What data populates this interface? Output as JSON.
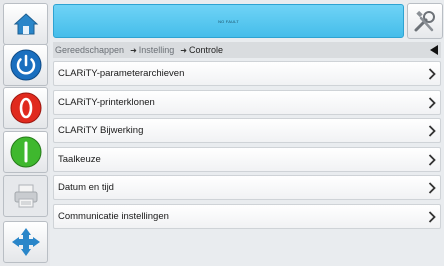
{
  "topbar": {
    "status_text": "NO FAULT"
  },
  "breadcrumb": {
    "root": "Gereedschappen",
    "middle": "Instelling",
    "current": "Controle"
  },
  "menu": {
    "items": [
      {
        "label": "CLARiTY-parameterarchieven"
      },
      {
        "label": "CLARiTY-printerklonen"
      },
      {
        "label": "CLARiTY Bijwerking"
      },
      {
        "label": "Taalkeuze"
      },
      {
        "label": "Datum en tijd"
      },
      {
        "label": "Communicatie instellingen"
      }
    ]
  },
  "icons": {
    "home": "home-icon",
    "power": "power-icon",
    "stop": "stop-icon",
    "start": "start-icon",
    "print": "printer-icon",
    "navigate": "navigation-arrows-icon",
    "tools": "tools-icon",
    "back": "back-arrow-icon",
    "chevron": "chevron-right-icon"
  },
  "colors": {
    "accent": "#45bdea",
    "power_blue": "#1a6fbf",
    "stop_red": "#e02a1e",
    "start_green": "#3fb82e"
  }
}
